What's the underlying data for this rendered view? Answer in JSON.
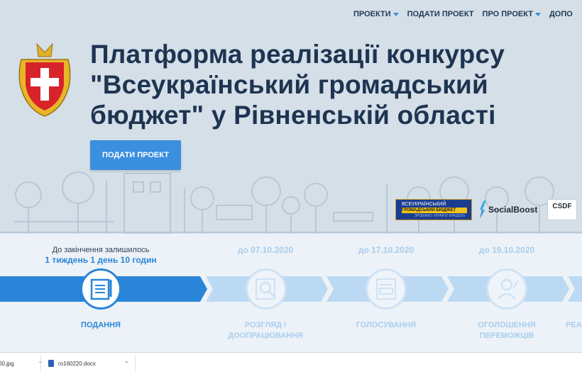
{
  "nav": {
    "items": [
      {
        "label": "ПРОЕКТИ",
        "has_caret": true
      },
      {
        "label": "ПОДАТИ ПРОЕКТ",
        "has_caret": false
      },
      {
        "label": "ПРО ПРОЕКТ",
        "has_caret": true
      },
      {
        "label": "ДОПО",
        "has_caret": false
      }
    ]
  },
  "hero": {
    "title": "Платформа реалізації конкурсу \"Всеукраїнський громадський бюджет\" у Рівненській області",
    "cta_label": "ПОДАТИ ПРОЕКТ",
    "partners": {
      "vgb_line1": "ВСЕУКРАЇНСЬКИЙ",
      "vgb_line2": "ГРОМАДСЬКИЙ БЮДЖЕТ",
      "vgb_line3": "ЗРОБИМО УКРАЇНУ КРАЩОЮ",
      "socialboost": "SocialBoost",
      "csdf": "CSDF"
    }
  },
  "timeline": {
    "countdown_label": "До закінчення залишилось",
    "countdown_value": "1 тиждень 1 день 10 годин",
    "stages": [
      {
        "date": "",
        "label_line1": "ПОДАННЯ",
        "label_line2": "",
        "active": true,
        "icon": "document-pen-icon"
      },
      {
        "date": "до 07.10.2020",
        "label_line1": "РОЗГЛЯД І",
        "label_line2": "ДООПРАЦЮВАННЯ",
        "active": false,
        "icon": "magnifier-document-icon"
      },
      {
        "date": "до 17.10.2020",
        "label_line1": "ГОЛОСУВАННЯ",
        "label_line2": "",
        "active": false,
        "icon": "ballot-icon"
      },
      {
        "date": "до 19.10.2020",
        "label_line1": "ОГОЛОШЕННЯ",
        "label_line2": "ПЕРЕМОЖЦІВ",
        "active": false,
        "icon": "winner-person-icon"
      },
      {
        "date": "",
        "label_line1": "РЕАЛ",
        "label_line2": "",
        "active": false,
        "icon": ""
      }
    ]
  },
  "downloads": {
    "items": [
      {
        "name": "00.jpg"
      },
      {
        "name": "ro160220.docx"
      }
    ]
  },
  "colors": {
    "accent": "#2a85d8",
    "hero_bg": "#d5dfe8",
    "title": "#1e3451",
    "inactive": "#a9cdee"
  }
}
